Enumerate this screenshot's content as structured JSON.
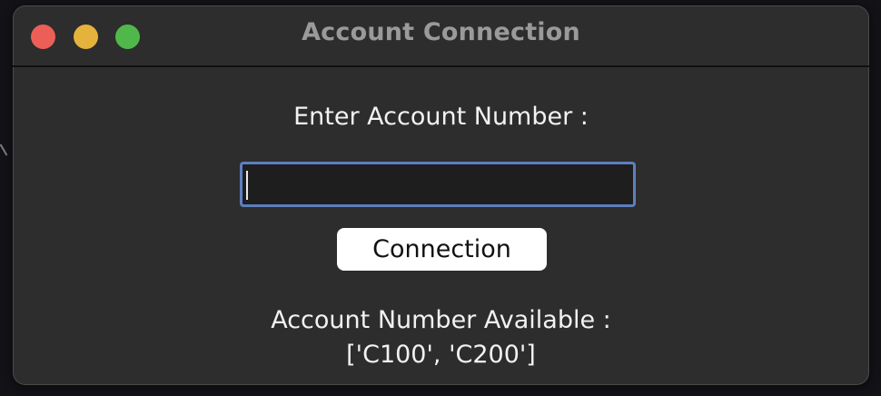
{
  "window": {
    "title": "Account Connection",
    "controls": {
      "close": {
        "name": "close-button",
        "color": "#ec5f57"
      },
      "minimize": {
        "name": "minimize-button",
        "color": "#e5b23b"
      },
      "maximize": {
        "name": "maximize-button",
        "color": "#50b84a"
      }
    }
  },
  "form": {
    "prompt_label": "Enter Account Number :",
    "input_value": "",
    "input_placeholder": "",
    "button_label": "Connection",
    "available_label": "Account Number Available :",
    "available_values": "['C100', 'C200']"
  },
  "theme": {
    "window_background": "#2d2d2d",
    "input_border": "#5d7fbf",
    "input_background": "#1e1e1e",
    "button_background": "#ffffff",
    "text_color": "#f2f2f2"
  }
}
